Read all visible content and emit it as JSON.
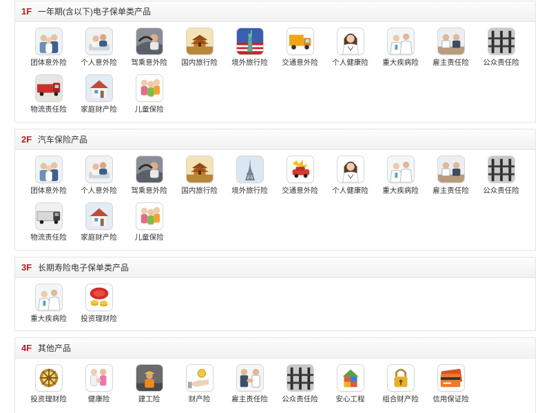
{
  "floors": [
    {
      "number": "1F",
      "title": "一年期(含以下)电子保单类产品",
      "products": [
        {
          "label": "团体意外险",
          "icon": "group-people-icon"
        },
        {
          "label": "个人意外险",
          "icon": "couple-relaxing-icon"
        },
        {
          "label": "驾乘意外险",
          "icon": "car-driver-icon"
        },
        {
          "label": "国内旅行险",
          "icon": "temple-icon"
        },
        {
          "label": "境外旅行险",
          "icon": "statue-of-liberty-icon"
        },
        {
          "label": "交通意外险",
          "icon": "truck-icon"
        },
        {
          "label": "个人健康险",
          "icon": "woman-doctor-icon"
        },
        {
          "label": "重大疾病险",
          "icon": "doctors-icon"
        },
        {
          "label": "雇主责任险",
          "icon": "business-meeting-icon"
        },
        {
          "label": "公众责任险",
          "icon": "bridge-structure-icon"
        },
        {
          "label": "物流责任险",
          "icon": "red-lorry-icon"
        },
        {
          "label": "家庭财产险",
          "icon": "house-icon"
        },
        {
          "label": "儿童保险",
          "icon": "children-icon"
        }
      ]
    },
    {
      "number": "2F",
      "title": "汽车保险产品",
      "products": [
        {
          "label": "团体意外险",
          "icon": "group-people-icon"
        },
        {
          "label": "个人意外险",
          "icon": "couple-relaxing-icon"
        },
        {
          "label": "驾乘意外险",
          "icon": "car-driver-icon"
        },
        {
          "label": "国内旅行险",
          "icon": "temple-icon"
        },
        {
          "label": "境外旅行险",
          "icon": "eiffel-tower-icon"
        },
        {
          "label": "交通意外险",
          "icon": "car-crash-icon"
        },
        {
          "label": "个人健康险",
          "icon": "woman-doctor-icon"
        },
        {
          "label": "重大疾病险",
          "icon": "doctors-icon"
        },
        {
          "label": "雇主责任险",
          "icon": "business-meeting-icon"
        },
        {
          "label": "公众责任险",
          "icon": "bridge-structure-icon"
        },
        {
          "label": "物流责任险",
          "icon": "lorry-icon"
        },
        {
          "label": "家庭财产险",
          "icon": "house-icon"
        },
        {
          "label": "儿童保险",
          "icon": "children-icon"
        }
      ]
    },
    {
      "number": "3F",
      "title": "长期寿险电子保单类产品",
      "products": [
        {
          "label": "重大疾病险",
          "icon": "doctors-icon"
        },
        {
          "label": "投资理财险",
          "icon": "gold-coins-icon"
        }
      ]
    },
    {
      "number": "4F",
      "title": "其他产品",
      "products": [
        {
          "label": "投资理财险",
          "icon": "gold-wheel-icon"
        },
        {
          "label": "健康险",
          "icon": "family-icon"
        },
        {
          "label": "建工险",
          "icon": "construction-worker-icon"
        },
        {
          "label": "财产险",
          "icon": "hand-coin-icon"
        },
        {
          "label": "雇主责任险",
          "icon": "handshake-icon"
        },
        {
          "label": "公众责任险",
          "icon": "bridge-structure-icon"
        },
        {
          "label": "安心工程",
          "icon": "house-blocks-icon"
        },
        {
          "label": "组合财产险",
          "icon": "gold-padlock-icon"
        },
        {
          "label": "信用保证险",
          "icon": "credit-card-icon"
        }
      ]
    }
  ]
}
